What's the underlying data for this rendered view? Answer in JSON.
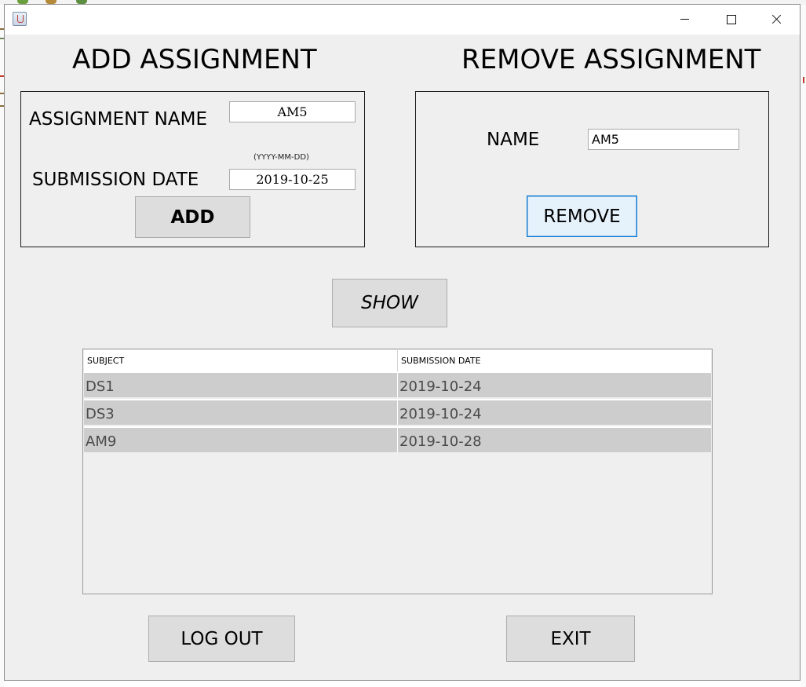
{
  "add_section": {
    "heading": "ADD ASSIGNMENT",
    "name_label": "ASSIGNMENT NAME",
    "name_value": "AM5",
    "date_hint": "(YYYY-MM-DD)",
    "date_label": "SUBMISSION DATE",
    "date_value": "2019-10-25",
    "add_button": "ADD"
  },
  "remove_section": {
    "heading": "REMOVE ASSIGNMENT",
    "name_label": "NAME",
    "name_value": "AM5",
    "remove_button": "REMOVE"
  },
  "show_button": "SHOW",
  "table": {
    "columns": [
      "SUBJECT",
      "SUBMISSION DATE"
    ],
    "rows": [
      [
        "DS1",
        "2019-10-24"
      ],
      [
        "DS3",
        "2019-10-24"
      ],
      [
        "AM9",
        "2019-10-28"
      ]
    ]
  },
  "logout_button": "LOG OUT",
  "exit_button": "EXIT",
  "colors": {
    "window_bg": "#efefef",
    "button_bg": "#dddddd",
    "focus_border": "#0078d7",
    "selected_row": "#cdcdcd"
  }
}
